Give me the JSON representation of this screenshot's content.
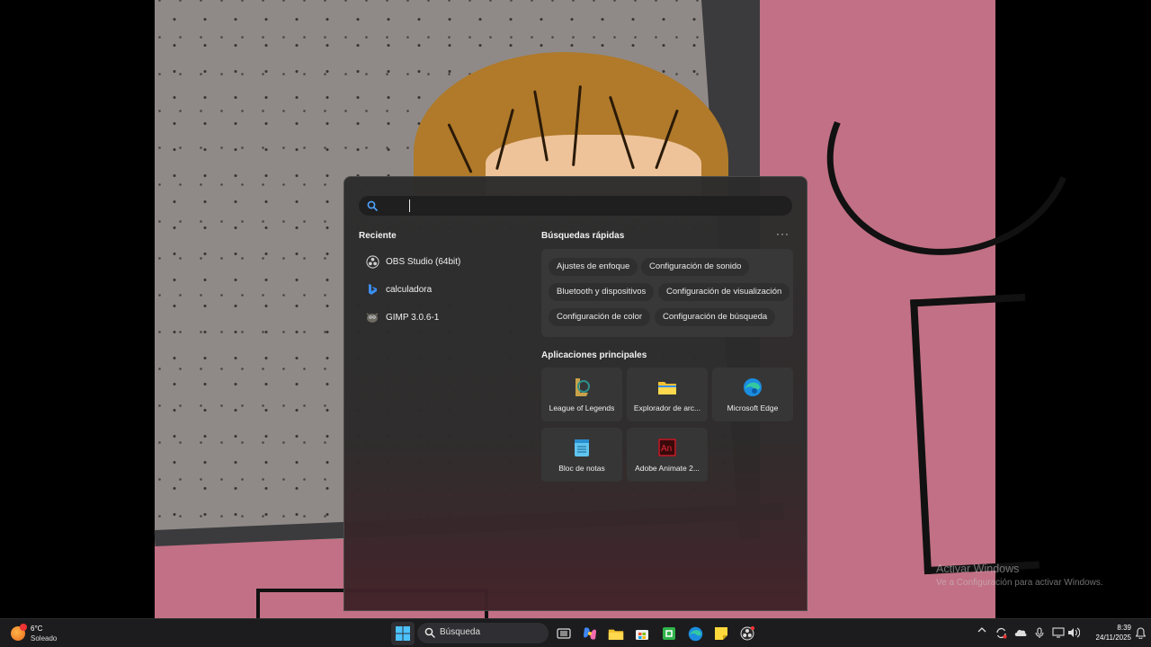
{
  "search": {
    "value": "",
    "placeholder": ""
  },
  "recent": {
    "heading": "Reciente",
    "items": [
      {
        "label": "OBS Studio (64bit)",
        "icon": "obs-icon"
      },
      {
        "label": "calculadora",
        "icon": "bing-icon"
      },
      {
        "label": "GIMP 3.0.6-1",
        "icon": "gimp-icon"
      }
    ]
  },
  "quick": {
    "heading": "Búsquedas rápidas",
    "more": "···",
    "chips": [
      "Ajustes de enfoque",
      "Configuración de sonido",
      "Bluetooth y dispositivos",
      "Configuración de visualización",
      "Configuración de color",
      "Configuración de búsqueda"
    ]
  },
  "apps": {
    "heading": "Aplicaciones principales",
    "items": [
      {
        "label": "League of Legends",
        "icon": "league-of-legends-icon"
      },
      {
        "label": "Explorador de arc...",
        "icon": "folder-icon"
      },
      {
        "label": "Microsoft Edge",
        "icon": "edge-icon"
      },
      {
        "label": "Bloc de notas",
        "icon": "notepad-icon"
      },
      {
        "label": "Adobe Animate 2...",
        "icon": "adobe-animate-icon"
      }
    ]
  },
  "watermark": {
    "title": "Activar Windows",
    "subtitle": "Ve a Configuración para activar Windows."
  },
  "taskbar": {
    "weather_temp": "6°C",
    "weather_condition": "Soleado",
    "search_label": "Búsqueda",
    "time": "8:39",
    "date": "24/11/2025"
  }
}
